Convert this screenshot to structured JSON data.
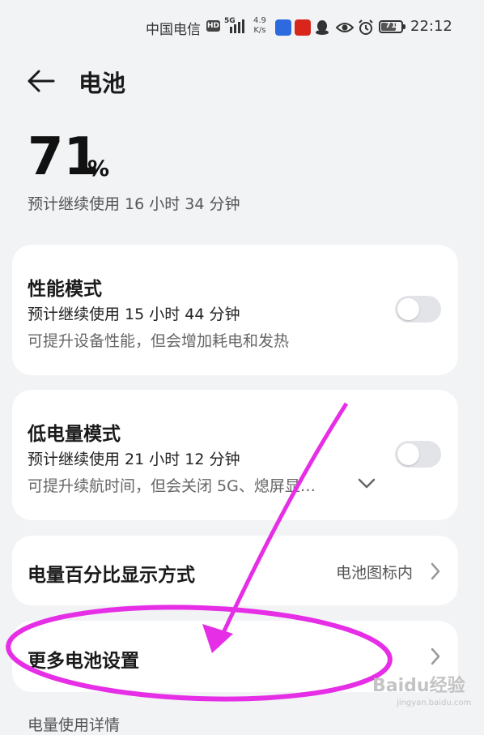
{
  "status_bar": {
    "carrier": "中国电信",
    "hd_badge": "HD",
    "network": "5G",
    "speed_value": "4.9",
    "speed_unit": "K/s",
    "battery_level": "71",
    "time": "22:12",
    "icons": [
      "signal-icon",
      "app-icon-blue",
      "app-icon-red",
      "qq-icon",
      "eye-icon",
      "alarm-icon",
      "battery-icon"
    ]
  },
  "header": {
    "title": "电池",
    "back_icon": "back-arrow-icon"
  },
  "battery": {
    "percent": "71",
    "unit": "%",
    "remaining": "预计继续使用 16 小时 34 分钟"
  },
  "performance_mode": {
    "title": "性能模式",
    "estimate": "预计继续使用 15 小时 44 分钟",
    "description": "可提升设备性能，但会增加耗电和发热",
    "enabled": false
  },
  "low_power_mode": {
    "title": "低电量模式",
    "estimate": "预计继续使用 21 小时 12 分钟",
    "description": "可提升续航时间，但会关闭 5G、熄屏显…",
    "enabled": false
  },
  "percentage_display": {
    "title": "电量百分比显示方式",
    "value": "电池图标内"
  },
  "more_settings": {
    "title": "更多电池设置"
  },
  "next_section": {
    "title": "电量使用详情"
  },
  "colors": {
    "background": "#f1f3f5",
    "card": "#ffffff",
    "annotation": "#e62ee6",
    "toggle_off": "#e2e4e7"
  },
  "watermark": {
    "text": "Baidu经验",
    "sub": "jingyan.baidu.com"
  }
}
